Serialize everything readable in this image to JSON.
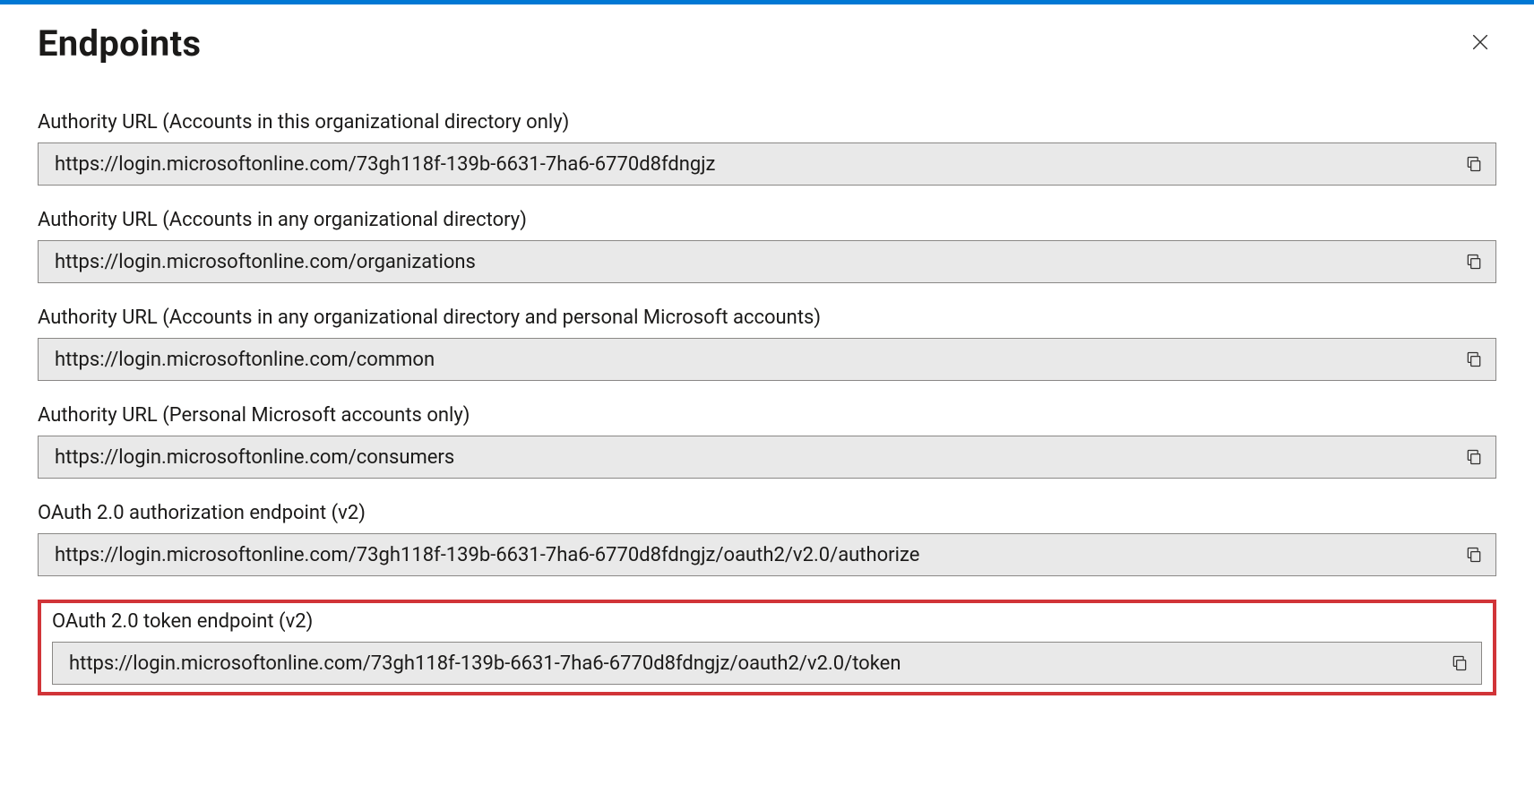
{
  "header": {
    "title": "Endpoints"
  },
  "endpoints": [
    {
      "label": "Authority URL (Accounts in this organizational directory only)",
      "value": "https://login.microsoftonline.com/73gh118f-139b-6631-7ha6-6770d8fdngjz"
    },
    {
      "label": "Authority URL (Accounts in any organizational directory)",
      "value": "https://login.microsoftonline.com/organizations"
    },
    {
      "label": "Authority URL (Accounts in any organizational directory and personal Microsoft accounts)",
      "value": "https://login.microsoftonline.com/common"
    },
    {
      "label": "Authority URL (Personal Microsoft accounts only)",
      "value": "https://login.microsoftonline.com/consumers"
    },
    {
      "label": "OAuth 2.0 authorization endpoint (v2)",
      "value": "https://login.microsoftonline.com/73gh118f-139b-6631-7ha6-6770d8fdngjz/oauth2/v2.0/authorize"
    },
    {
      "label": "OAuth 2.0 token endpoint (v2)",
      "value": "https://login.microsoftonline.com/73gh118f-139b-6631-7ha6-6770d8fdngjz/oauth2/v2.0/token"
    }
  ],
  "highlighted_index": 5
}
